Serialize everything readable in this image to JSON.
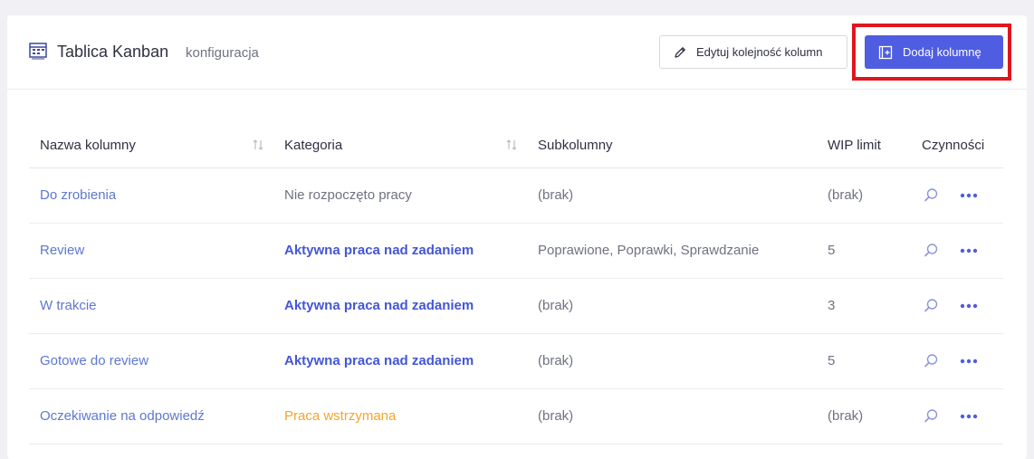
{
  "header": {
    "title": "Tablica Kanban",
    "subtitle": "konfiguracja",
    "edit_button_label": "Edytuj kolejność kolumn",
    "add_button_label": "Dodaj kolumnę"
  },
  "table": {
    "headers": {
      "name": "Nazwa kolumny",
      "category": "Kategoria",
      "subcolumns": "Subkolumny",
      "wip": "WIP limit",
      "actions": "Czynności"
    },
    "rows": [
      {
        "name": "Do zrobienia",
        "category": "Nie rozpoczęto pracy",
        "category_type": "none",
        "subcolumns": "(brak)",
        "wip": "(brak)"
      },
      {
        "name": "Review",
        "category": "Aktywna praca nad zadaniem",
        "category_type": "active",
        "subcolumns": "Poprawione, Poprawki, Sprawdzanie",
        "wip": "5"
      },
      {
        "name": "W trakcie",
        "category": "Aktywna praca nad zadaniem",
        "category_type": "active",
        "subcolumns": "(brak)",
        "wip": "3"
      },
      {
        "name": "Gotowe do review",
        "category": "Aktywna praca nad zadaniem",
        "category_type": "active",
        "subcolumns": "(brak)",
        "wip": "5"
      },
      {
        "name": "Oczekiwanie na odpowiedź",
        "category": "Praca wstrzymana",
        "category_type": "paused",
        "subcolumns": "(brak)",
        "wip": "(brak)"
      }
    ]
  },
  "icons": {
    "board": "kanban-board-icon",
    "edit": "pencil-icon",
    "add": "add-column-icon",
    "sort": "sort-icon",
    "search": "search-icon",
    "more": "more-dots-icon"
  },
  "colors": {
    "accent": "#4f5de0",
    "link": "#5d78cf",
    "category_active": "#4356d6",
    "category_paused": "#f3a52a",
    "highlight": "#e0161e"
  }
}
